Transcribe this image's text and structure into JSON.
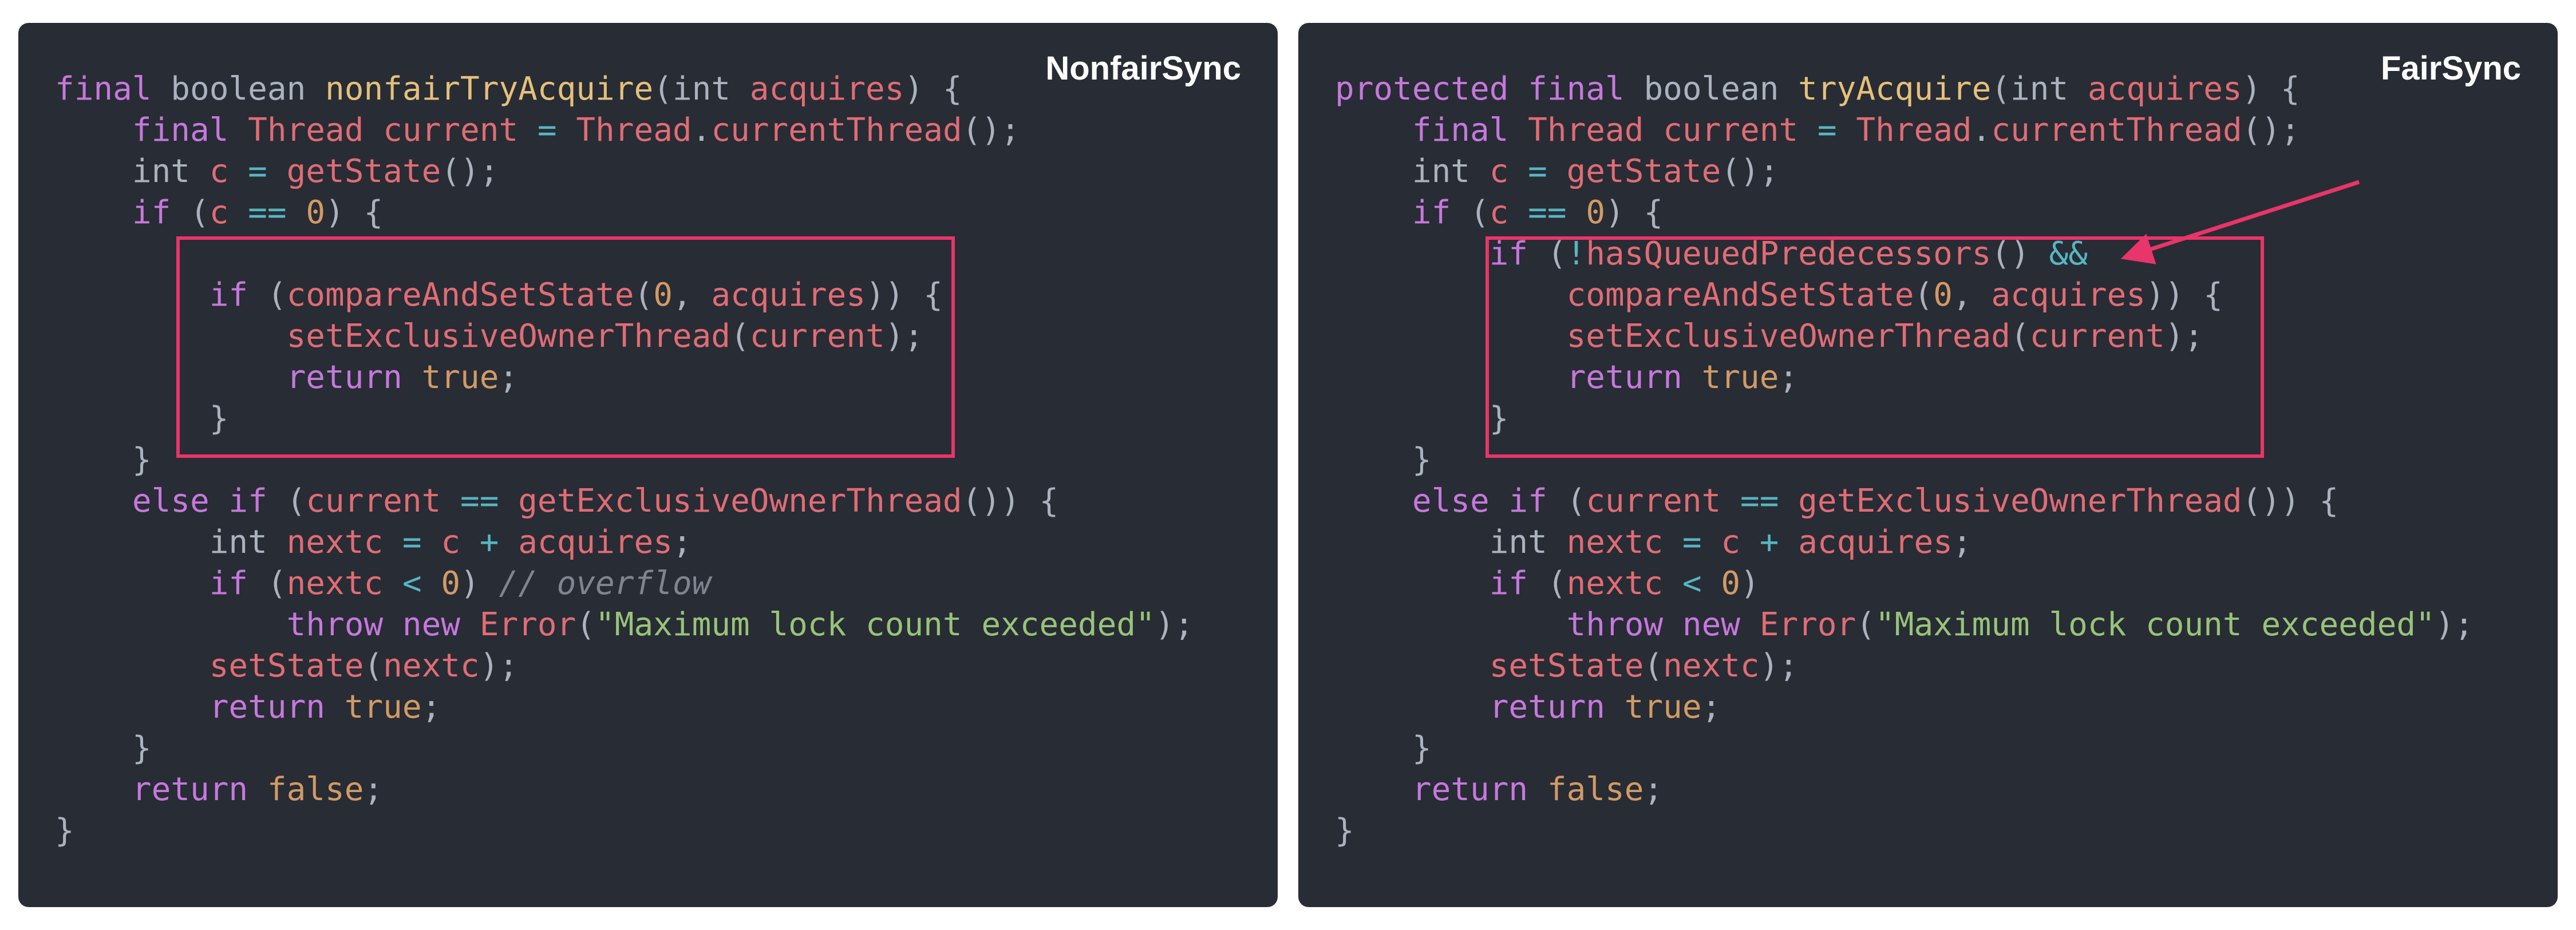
{
  "left_panel": {
    "title": "NonfairSync",
    "lines": [
      [
        [
          "kw",
          "final"
        ],
        [
          "pn",
          " boolean "
        ],
        [
          "fn",
          "nonfairTryAcquire"
        ],
        [
          "pn",
          "(int "
        ],
        [
          "vr",
          "acquires"
        ],
        [
          "pn",
          ") {"
        ]
      ],
      [
        [
          "pn",
          "    "
        ],
        [
          "kw",
          "final"
        ],
        [
          "pn",
          " "
        ],
        [
          "ty",
          "Thread"
        ],
        [
          "pn",
          " "
        ],
        [
          "vr",
          "current"
        ],
        [
          "pn",
          " "
        ],
        [
          "op",
          "="
        ],
        [
          "pn",
          " "
        ],
        [
          "ty",
          "Thread"
        ],
        [
          "pn",
          "."
        ],
        [
          "cl",
          "currentThread"
        ],
        [
          "pn",
          "();"
        ]
      ],
      [
        [
          "pn",
          "    int "
        ],
        [
          "vr",
          "c"
        ],
        [
          "pn",
          " "
        ],
        [
          "op",
          "="
        ],
        [
          "pn",
          " "
        ],
        [
          "cl",
          "getState"
        ],
        [
          "pn",
          "();"
        ]
      ],
      [
        [
          "pn",
          "    "
        ],
        [
          "kw",
          "if"
        ],
        [
          "pn",
          " ("
        ],
        [
          "vr",
          "c"
        ],
        [
          "pn",
          " "
        ],
        [
          "op",
          "=="
        ],
        [
          "pn",
          " "
        ],
        [
          "nm",
          "0"
        ],
        [
          "pn",
          ") {"
        ]
      ],
      [
        [
          "pn",
          ""
        ]
      ],
      [
        [
          "pn",
          "        "
        ],
        [
          "kw",
          "if"
        ],
        [
          "pn",
          " ("
        ],
        [
          "cl",
          "compareAndSetState"
        ],
        [
          "pn",
          "("
        ],
        [
          "nm",
          "0"
        ],
        [
          "pn",
          ", "
        ],
        [
          "vr",
          "acquires"
        ],
        [
          "pn",
          ")) {"
        ]
      ],
      [
        [
          "pn",
          "            "
        ],
        [
          "cl",
          "setExclusiveOwnerThread"
        ],
        [
          "pn",
          "("
        ],
        [
          "vr",
          "current"
        ],
        [
          "pn",
          ");"
        ]
      ],
      [
        [
          "pn",
          "            "
        ],
        [
          "kw",
          "return"
        ],
        [
          "pn",
          " "
        ],
        [
          "bo",
          "true"
        ],
        [
          "pn",
          ";"
        ]
      ],
      [
        [
          "pn",
          "        }"
        ]
      ],
      [
        [
          "pn",
          "    }"
        ]
      ],
      [
        [
          "pn",
          "    "
        ],
        [
          "kw",
          "else if"
        ],
        [
          "pn",
          " ("
        ],
        [
          "vr",
          "current"
        ],
        [
          "pn",
          " "
        ],
        [
          "op",
          "=="
        ],
        [
          "pn",
          " "
        ],
        [
          "cl",
          "getExclusiveOwnerThread"
        ],
        [
          "pn",
          "()) {"
        ]
      ],
      [
        [
          "pn",
          "        int "
        ],
        [
          "vr",
          "nextc"
        ],
        [
          "pn",
          " "
        ],
        [
          "op",
          "="
        ],
        [
          "pn",
          " "
        ],
        [
          "vr",
          "c"
        ],
        [
          "pn",
          " "
        ],
        [
          "op",
          "+"
        ],
        [
          "pn",
          " "
        ],
        [
          "vr",
          "acquires"
        ],
        [
          "pn",
          ";"
        ]
      ],
      [
        [
          "pn",
          "        "
        ],
        [
          "kw",
          "if"
        ],
        [
          "pn",
          " ("
        ],
        [
          "vr",
          "nextc"
        ],
        [
          "pn",
          " "
        ],
        [
          "op",
          "<"
        ],
        [
          "pn",
          " "
        ],
        [
          "nm",
          "0"
        ],
        [
          "pn",
          ") "
        ],
        [
          "cm",
          "// overflow"
        ]
      ],
      [
        [
          "pn",
          "            "
        ],
        [
          "kw",
          "throw new"
        ],
        [
          "pn",
          " "
        ],
        [
          "ty",
          "Error"
        ],
        [
          "pn",
          "("
        ],
        [
          "st",
          "\"Maximum lock count exceeded\""
        ],
        [
          "pn",
          ");"
        ]
      ],
      [
        [
          "pn",
          "        "
        ],
        [
          "cl",
          "setState"
        ],
        [
          "pn",
          "("
        ],
        [
          "vr",
          "nextc"
        ],
        [
          "pn",
          ");"
        ]
      ],
      [
        [
          "pn",
          "        "
        ],
        [
          "kw",
          "return"
        ],
        [
          "pn",
          " "
        ],
        [
          "bo",
          "true"
        ],
        [
          "pn",
          ";"
        ]
      ],
      [
        [
          "pn",
          "    }"
        ]
      ],
      [
        [
          "pn",
          "    "
        ],
        [
          "kw",
          "return"
        ],
        [
          "pn",
          " "
        ],
        [
          "bo",
          "false"
        ],
        [
          "pn",
          ";"
        ]
      ],
      [
        [
          "pn",
          "}"
        ]
      ]
    ]
  },
  "right_panel": {
    "title": "FairSync",
    "lines": [
      [
        [
          "kw",
          "protected final"
        ],
        [
          "pn",
          " boolean "
        ],
        [
          "fn",
          "tryAcquire"
        ],
        [
          "pn",
          "(int "
        ],
        [
          "vr",
          "acquires"
        ],
        [
          "pn",
          ") {"
        ]
      ],
      [
        [
          "pn",
          "    "
        ],
        [
          "kw",
          "final"
        ],
        [
          "pn",
          " "
        ],
        [
          "ty",
          "Thread"
        ],
        [
          "pn",
          " "
        ],
        [
          "vr",
          "current"
        ],
        [
          "pn",
          " "
        ],
        [
          "op",
          "="
        ],
        [
          "pn",
          " "
        ],
        [
          "ty",
          "Thread"
        ],
        [
          "pn",
          "."
        ],
        [
          "cl",
          "currentThread"
        ],
        [
          "pn",
          "();"
        ]
      ],
      [
        [
          "pn",
          "    int "
        ],
        [
          "vr",
          "c"
        ],
        [
          "pn",
          " "
        ],
        [
          "op",
          "="
        ],
        [
          "pn",
          " "
        ],
        [
          "cl",
          "getState"
        ],
        [
          "pn",
          "();"
        ]
      ],
      [
        [
          "pn",
          "    "
        ],
        [
          "kw",
          "if"
        ],
        [
          "pn",
          " ("
        ],
        [
          "vr",
          "c"
        ],
        [
          "pn",
          " "
        ],
        [
          "op",
          "=="
        ],
        [
          "pn",
          " "
        ],
        [
          "nm",
          "0"
        ],
        [
          "pn",
          ") {"
        ]
      ],
      [
        [
          "pn",
          "        "
        ],
        [
          "kw",
          "if"
        ],
        [
          "pn",
          " ("
        ],
        [
          "op",
          "!"
        ],
        [
          "cl",
          "hasQueuedPredecessors"
        ],
        [
          "pn",
          "() "
        ],
        [
          "op",
          "&&"
        ]
      ],
      [
        [
          "pn",
          "            "
        ],
        [
          "cl",
          "compareAndSetState"
        ],
        [
          "pn",
          "("
        ],
        [
          "nm",
          "0"
        ],
        [
          "pn",
          ", "
        ],
        [
          "vr",
          "acquires"
        ],
        [
          "pn",
          ")) {"
        ]
      ],
      [
        [
          "pn",
          "            "
        ],
        [
          "cl",
          "setExclusiveOwnerThread"
        ],
        [
          "pn",
          "("
        ],
        [
          "vr",
          "current"
        ],
        [
          "pn",
          ");"
        ]
      ],
      [
        [
          "pn",
          "            "
        ],
        [
          "kw",
          "return"
        ],
        [
          "pn",
          " "
        ],
        [
          "bo",
          "true"
        ],
        [
          "pn",
          ";"
        ]
      ],
      [
        [
          "pn",
          "        }"
        ]
      ],
      [
        [
          "pn",
          "    }"
        ]
      ],
      [
        [
          "pn",
          "    "
        ],
        [
          "kw",
          "else if"
        ],
        [
          "pn",
          " ("
        ],
        [
          "vr",
          "current"
        ],
        [
          "pn",
          " "
        ],
        [
          "op",
          "=="
        ],
        [
          "pn",
          " "
        ],
        [
          "cl",
          "getExclusiveOwnerThread"
        ],
        [
          "pn",
          "()) {"
        ]
      ],
      [
        [
          "pn",
          "        int "
        ],
        [
          "vr",
          "nextc"
        ],
        [
          "pn",
          " "
        ],
        [
          "op",
          "="
        ],
        [
          "pn",
          " "
        ],
        [
          "vr",
          "c"
        ],
        [
          "pn",
          " "
        ],
        [
          "op",
          "+"
        ],
        [
          "pn",
          " "
        ],
        [
          "vr",
          "acquires"
        ],
        [
          "pn",
          ";"
        ]
      ],
      [
        [
          "pn",
          "        "
        ],
        [
          "kw",
          "if"
        ],
        [
          "pn",
          " ("
        ],
        [
          "vr",
          "nextc"
        ],
        [
          "pn",
          " "
        ],
        [
          "op",
          "<"
        ],
        [
          "pn",
          " "
        ],
        [
          "nm",
          "0"
        ],
        [
          "pn",
          ")"
        ]
      ],
      [
        [
          "pn",
          "            "
        ],
        [
          "kw",
          "throw new"
        ],
        [
          "pn",
          " "
        ],
        [
          "ty",
          "Error"
        ],
        [
          "pn",
          "("
        ],
        [
          "st",
          "\"Maximum lock count exceeded\""
        ],
        [
          "pn",
          ");"
        ]
      ],
      [
        [
          "pn",
          "        "
        ],
        [
          "cl",
          "setState"
        ],
        [
          "pn",
          "("
        ],
        [
          "vr",
          "nextc"
        ],
        [
          "pn",
          ");"
        ]
      ],
      [
        [
          "pn",
          "        "
        ],
        [
          "kw",
          "return"
        ],
        [
          "pn",
          " "
        ],
        [
          "bo",
          "true"
        ],
        [
          "pn",
          ";"
        ]
      ],
      [
        [
          "pn",
          "    }"
        ]
      ],
      [
        [
          "pn",
          "    "
        ],
        [
          "kw",
          "return"
        ],
        [
          "pn",
          " "
        ],
        [
          "bo",
          "false"
        ],
        [
          "pn",
          ";"
        ]
      ],
      [
        [
          "pn",
          "}"
        ]
      ]
    ]
  },
  "colors": {
    "panel_background": "#282c34",
    "highlight_box": "#e8356a",
    "arrow": "#e8356a",
    "keyword": "#c678dd",
    "function_name": "#e5c07b",
    "identifier": "#e06c75",
    "number_boolean": "#d19a66",
    "operator": "#56b6c2",
    "string": "#98c379",
    "comment": "#7f848e",
    "punctuation": "#abb2bf"
  }
}
